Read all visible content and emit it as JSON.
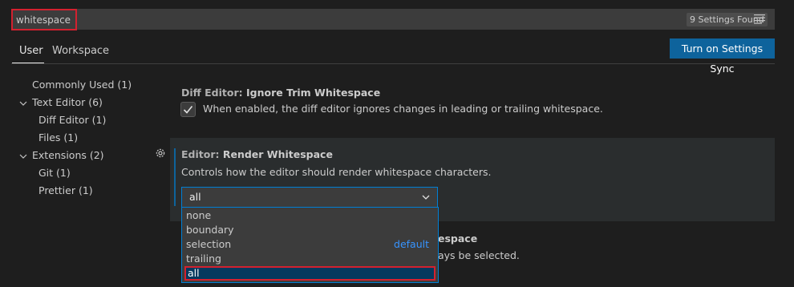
{
  "search": {
    "value": "whitespace",
    "results_badge": "9 Settings Found"
  },
  "tabs": {
    "user": "User",
    "workspace": "Workspace"
  },
  "sync_button": "Turn on Settings Sync",
  "toc": [
    {
      "label": "Commonly Used (1)"
    },
    {
      "label": "Text Editor (6)"
    },
    {
      "label": "Diff Editor (1)"
    },
    {
      "label": "Files (1)"
    },
    {
      "label": "Extensions (2)"
    },
    {
      "label": "Git (1)"
    },
    {
      "label": "Prettier (1)"
    }
  ],
  "settings": {
    "diff_ignore": {
      "category": "Diff Editor: ",
      "name": "Ignore Trim Whitespace",
      "description": "When enabled, the diff editor ignores changes in leading or trailing whitespace.",
      "checked": true
    },
    "render_whitespace": {
      "category": "Editor: ",
      "name": "Render Whitespace",
      "description": "Controls how the editor should render whitespace characters.",
      "value": "all",
      "options": [
        "none",
        "boundary",
        "selection",
        "trailing",
        "all"
      ],
      "default_tag": "default"
    },
    "partial": {
      "title_fragment": "espace",
      "desc_fragment": "ays be selected."
    }
  },
  "colors": {
    "accent": "#0e639c",
    "highlight_border": "#d3212f",
    "link": "#3794ff"
  }
}
